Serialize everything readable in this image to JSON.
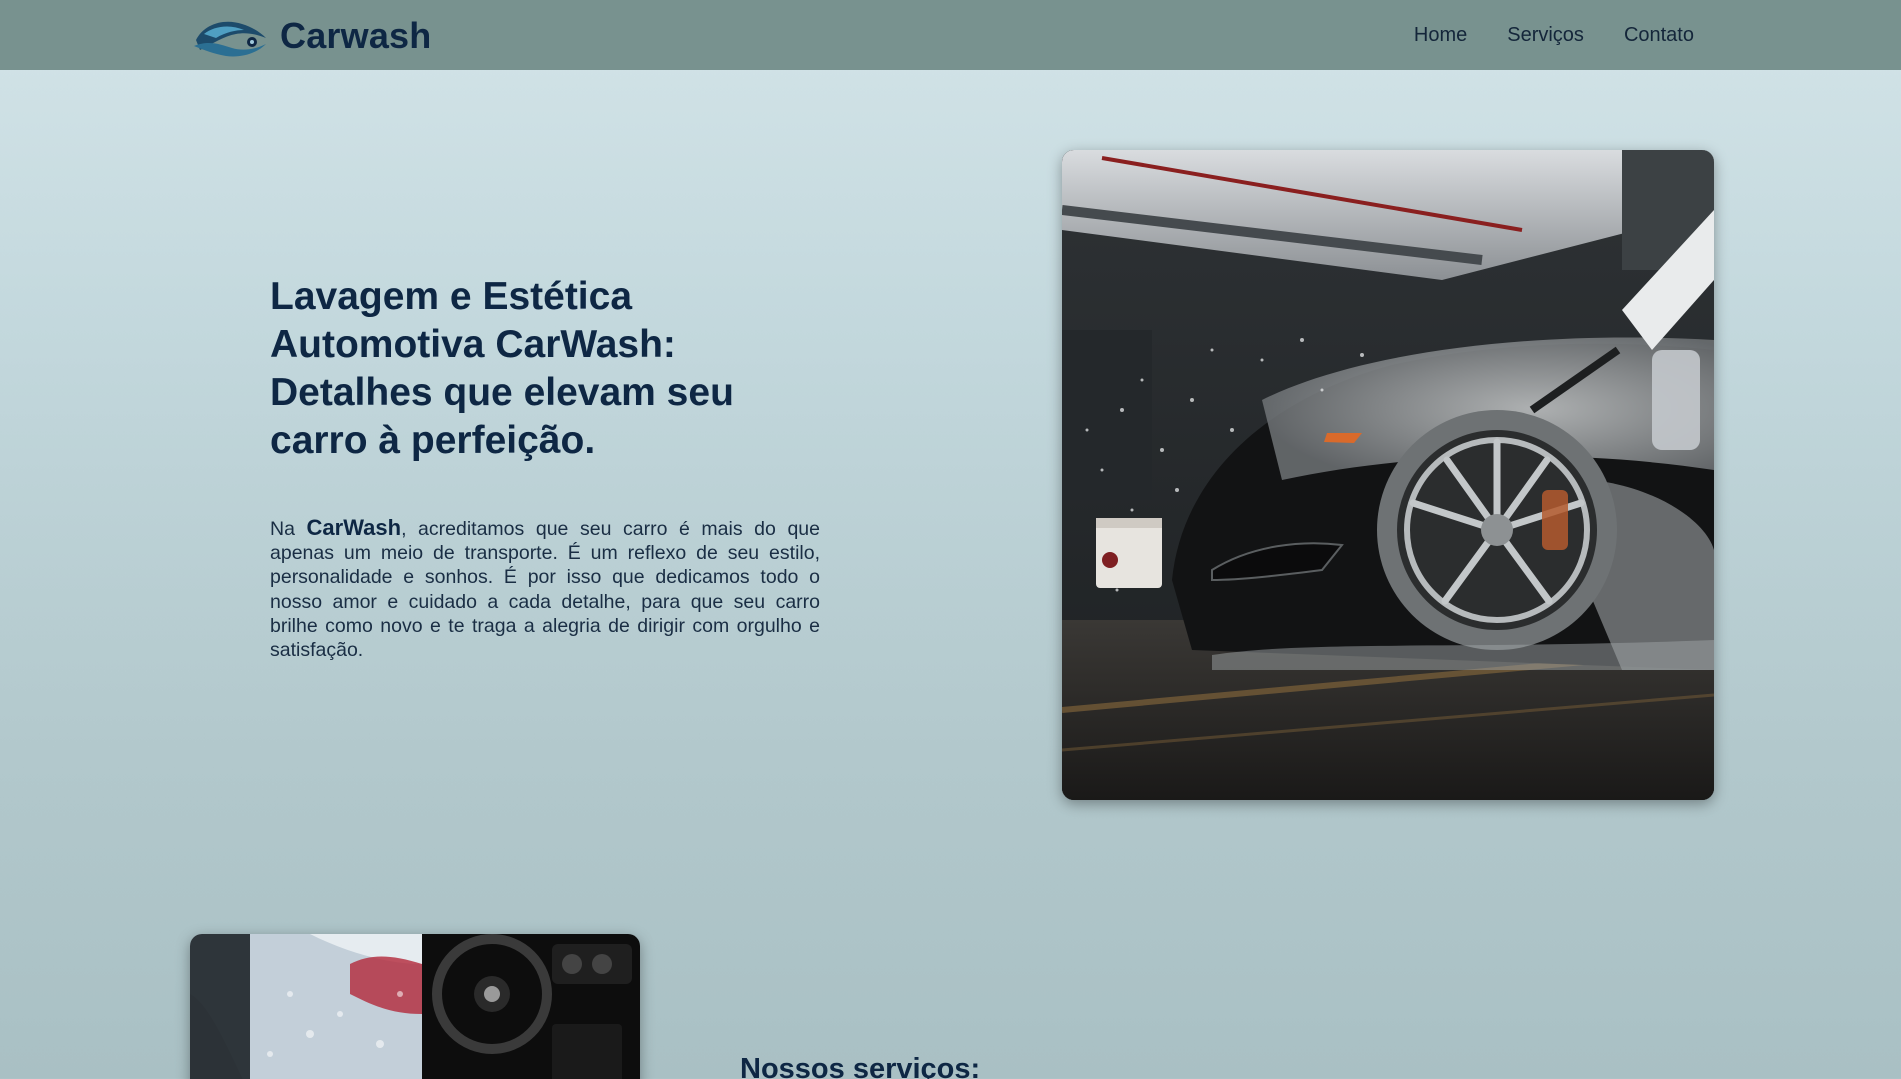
{
  "header": {
    "brand_name": "Carwash",
    "logo_icon": "car-wave-logo-icon",
    "nav": [
      {
        "label": "Home"
      },
      {
        "label": "Serviços"
      },
      {
        "label": "Contato"
      }
    ]
  },
  "hero": {
    "title": "Lavagem e Estética Automotiva CarWash: Detalhes que elevam seu carro à perfeição.",
    "text_prefix": "Na ",
    "text_brand": "CarWash",
    "text_body": ", acreditamos que seu carro é mais do que apenas um meio de transporte. É um reflexo de seu estilo, personalidade e sonhos. É por isso que dedicamos todo o nosso amor e cuidado a cada detalhe, para que seu carro brilhe como novo e te traga a alegria de dirigir com orgulho e satisfação.",
    "image": "foam-covered-sports-car-photo"
  },
  "services": {
    "title": "Nossos serviços:",
    "image": "car-foam-and-interior-photo"
  },
  "colors": {
    "header_bg": "#78928f",
    "text_dark": "#0e2744",
    "page_bg_top": "#d3e4e8",
    "page_bg_bottom": "#a9c0c4"
  }
}
